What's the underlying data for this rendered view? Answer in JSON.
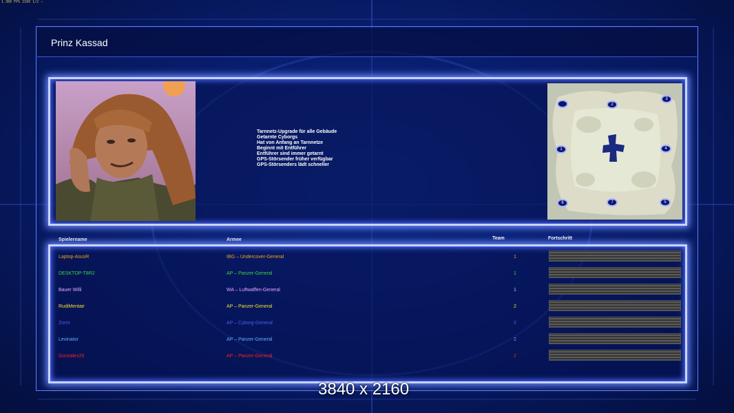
{
  "header": {
    "title": "Prinz Kassad",
    "corner_text": "1.360 FPS 2160 1/2 —"
  },
  "general": {
    "portrait": "prinz-kassad-portrait",
    "description": [
      "Tarnnetz-Upgrade für alle Gebäude",
      "Getarnte Cyborgs",
      "Hat von Anfang an Tarnnetze",
      "Beginnt mit Entführer",
      "Entführer sind immer getarnt",
      "GPS-Störsender früher verfügbar",
      "GPS-Störsenders lädt schneller"
    ]
  },
  "map": {
    "positions": [
      "2",
      "3",
      "1",
      "4",
      "6",
      "7",
      "5"
    ]
  },
  "columns": {
    "player": "Spielername",
    "army": "Armee",
    "team": "Team",
    "progress": "Fortschritt"
  },
  "players": [
    {
      "name": "Laptop-AsusR",
      "army": "IBG – Undercover-General",
      "team": "1",
      "color": "#e8a81c"
    },
    {
      "name": "DESKTOP-T8R2",
      "army": "AP – Panzer-General",
      "team": "1",
      "color": "#3fd43f"
    },
    {
      "name": "Bauer Willi",
      "army": "WA – Luftwaffen-General",
      "team": "1",
      "color": "#e8a8ff"
    },
    {
      "name": "RudiMentair",
      "army": "AP – Panzer-General",
      "team": "2",
      "color": "#f0e02a"
    },
    {
      "name": "Zorro",
      "army": "AP – Cyborg-General",
      "team": "2",
      "color": "#4f5cf0"
    },
    {
      "name": "Levinator",
      "army": "AP – Panzer-General",
      "team": "2",
      "color": "#5fb0ff"
    },
    {
      "name": "Gonzalez25",
      "army": "AP – Panzer-General",
      "team": "2",
      "color": "#ff2020"
    }
  ],
  "overlay": {
    "resolution": "3840 x 2160"
  }
}
